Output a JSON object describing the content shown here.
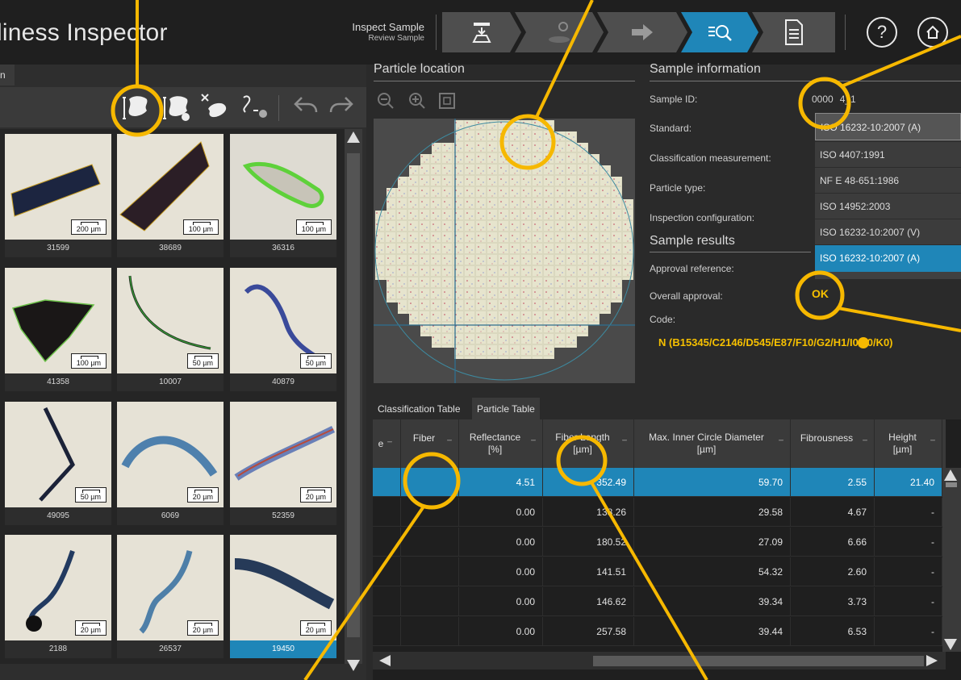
{
  "app": {
    "title": "liness Inspector"
  },
  "header": {
    "mode_primary": "Inspect Sample",
    "mode_secondary": "Review Sample",
    "steps": [
      "load-sample-icon",
      "settings-icon",
      "arrow-right-icon",
      "review-search-icon",
      "report-document-icon"
    ],
    "help_label": "?",
    "colors": {
      "accent": "#1f86b8",
      "highlight": "#f6b800",
      "ok_text": "#f6c000"
    }
  },
  "left_panel": {
    "tab_label": "n",
    "toolbar_icons": [
      "classify-particles-icon",
      "manual-classify-icon",
      "exclude-particle-icon",
      "merge-particles-icon",
      "undo-icon",
      "redo-icon"
    ],
    "tiles": [
      {
        "id": "31599",
        "scale": "200 µm"
      },
      {
        "id": "38689",
        "scale": "100 µm"
      },
      {
        "id": "36316",
        "scale": "100 µm"
      },
      {
        "id": "41358",
        "scale": "100 µm"
      },
      {
        "id": "10007",
        "scale": "50 µm"
      },
      {
        "id": "40879",
        "scale": "50 µm"
      },
      {
        "id": "49095",
        "scale": "50 µm"
      },
      {
        "id": "6069",
        "scale": "20 µm"
      },
      {
        "id": "52359",
        "scale": "20 µm"
      },
      {
        "id": "2188",
        "scale": "20 µm"
      },
      {
        "id": "26537",
        "scale": "20 µm"
      },
      {
        "id": "19450",
        "scale": "20 µm"
      }
    ]
  },
  "particle_location": {
    "title": "Particle location",
    "tools": [
      "zoom-out-icon",
      "zoom-in-icon",
      "fit-view-icon"
    ]
  },
  "sample_info": {
    "title": "Sample information",
    "labels": {
      "sample_id": "Sample ID:",
      "standard": "Standard:",
      "classification": "Classification measurement:",
      "particle_type": "Particle type:",
      "inspection_config": "Inspection configuration:"
    },
    "sample_id_value": "0000",
    "sample_id_suffix": "4_1",
    "standard_selected": "ISO 16232-10:2007 (A)",
    "standard_options": [
      "ISO 4407:1991",
      "NF E 48-651:1986",
      "ISO 14952:2003",
      "ISO 16232-10:2007 (V)",
      "ISO 16232-10:2007 (A)"
    ]
  },
  "sample_results": {
    "title": "Sample results",
    "labels": {
      "approval_reference": "Approval reference:",
      "overall_approval": "Overall approval:",
      "code": "Code:"
    },
    "overall_approval_value": "OK",
    "code_value": "N (B15345/C2146/D545/E87/F10/G2/H1/I0/J0/K0)"
  },
  "table": {
    "tabs": [
      "Classification Table",
      "Particle Table"
    ],
    "active_tab": 1,
    "columns": [
      {
        "label": "e",
        "unit": ""
      },
      {
        "label": "Fiber",
        "unit": ""
      },
      {
        "label": "Reflectance",
        "unit": "[%]"
      },
      {
        "label": "Fiber Length",
        "unit": "[µm]"
      },
      {
        "label": "Max. Inner Circle Diameter",
        "unit": "[µm]"
      },
      {
        "label": "Fibrousness",
        "unit": ""
      },
      {
        "label": "Height",
        "unit": "[µm]"
      }
    ],
    "rows": [
      [
        "",
        "",
        "4.51",
        "352.49",
        "59.70",
        "2.55",
        "21.40"
      ],
      [
        "",
        "",
        "0.00",
        "138.26",
        "29.58",
        "4.67",
        "-"
      ],
      [
        "",
        "",
        "0.00",
        "180.52",
        "27.09",
        "6.66",
        "-"
      ],
      [
        "",
        "",
        "0.00",
        "141.51",
        "54.32",
        "2.60",
        "-"
      ],
      [
        "",
        "",
        "0.00",
        "146.62",
        "39.34",
        "3.73",
        "-"
      ],
      [
        "",
        "",
        "0.00",
        "257.58",
        "39.44",
        "6.53",
        "-"
      ]
    ],
    "selected_row": 0
  }
}
